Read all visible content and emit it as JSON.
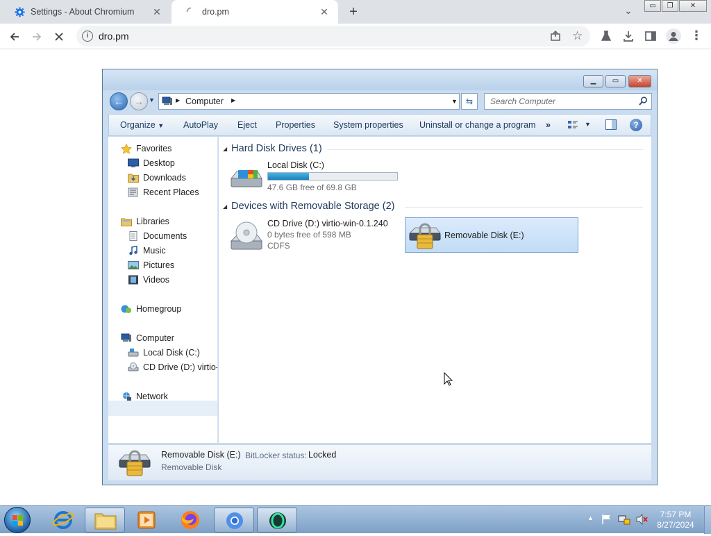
{
  "browser": {
    "tabs": [
      {
        "title": "Settings - About Chromium"
      },
      {
        "title": "dro.pm"
      }
    ],
    "new_tab_symbol": "+",
    "url": "dro.pm",
    "window_controls": {
      "minimize": "▭",
      "restore": "❐",
      "close": "✕"
    }
  },
  "explorer": {
    "breadcrumb": [
      "Computer"
    ],
    "search_placeholder": "Search Computer",
    "commands": [
      "Organize",
      "AutoPlay",
      "Eject",
      "Properties",
      "System properties",
      "Uninstall or change a program",
      "»"
    ],
    "nav": {
      "favorites": {
        "label": "Favorites",
        "items": [
          "Desktop",
          "Downloads",
          "Recent Places"
        ]
      },
      "libraries": {
        "label": "Libraries",
        "items": [
          "Documents",
          "Music",
          "Pictures",
          "Videos"
        ]
      },
      "homegroup": "Homegroup",
      "computer": {
        "label": "Computer",
        "items": [
          "Local Disk (C:)",
          "CD Drive (D:) virtio-w"
        ]
      },
      "network": "Network"
    },
    "groups": {
      "hdd": {
        "title": "Hard Disk Drives (1)",
        "drives": [
          {
            "name": "Local Disk (C:)",
            "free": "47.6 GB free of 69.8 GB",
            "used_fraction": 0.318
          }
        ]
      },
      "removable": {
        "title": "Devices with Removable Storage (2)",
        "drives": [
          {
            "name": "CD Drive (D:) virtio-win-0.1.240",
            "free": "0 bytes free of 598 MB",
            "fs": "CDFS"
          },
          {
            "name": "Removable Disk (E:)"
          }
        ]
      }
    },
    "details": {
      "name": "Removable Disk (E:)",
      "status_label": "BitLocker status:",
      "status_value": "Locked",
      "type": "Removable Disk"
    }
  },
  "taskbar": {
    "clock_time": "7:57 PM",
    "clock_date": "8/27/2024"
  }
}
